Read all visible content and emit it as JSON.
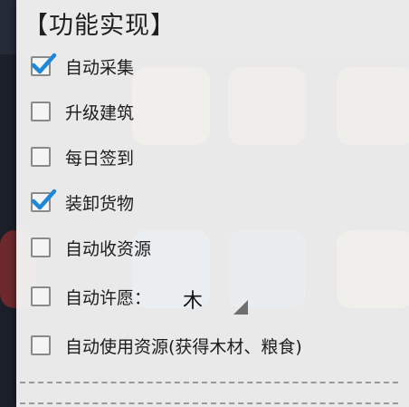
{
  "panel": {
    "title": "【功能实现】",
    "options": [
      {
        "label": "自动采集",
        "checked": true
      },
      {
        "label": "升级建筑",
        "checked": false
      },
      {
        "label": "每日签到",
        "checked": false
      },
      {
        "label": "装卸货物",
        "checked": true
      },
      {
        "label": "自动收资源",
        "checked": false
      },
      {
        "label": "自动许愿：",
        "checked": false
      },
      {
        "label": "自动使用资源(获得木材、粮食)",
        "checked": false
      }
    ],
    "wish_select": {
      "value": "木"
    }
  },
  "colors": {
    "check_blue": "#1e88d8",
    "panel_bg": "#f7f7f7"
  }
}
